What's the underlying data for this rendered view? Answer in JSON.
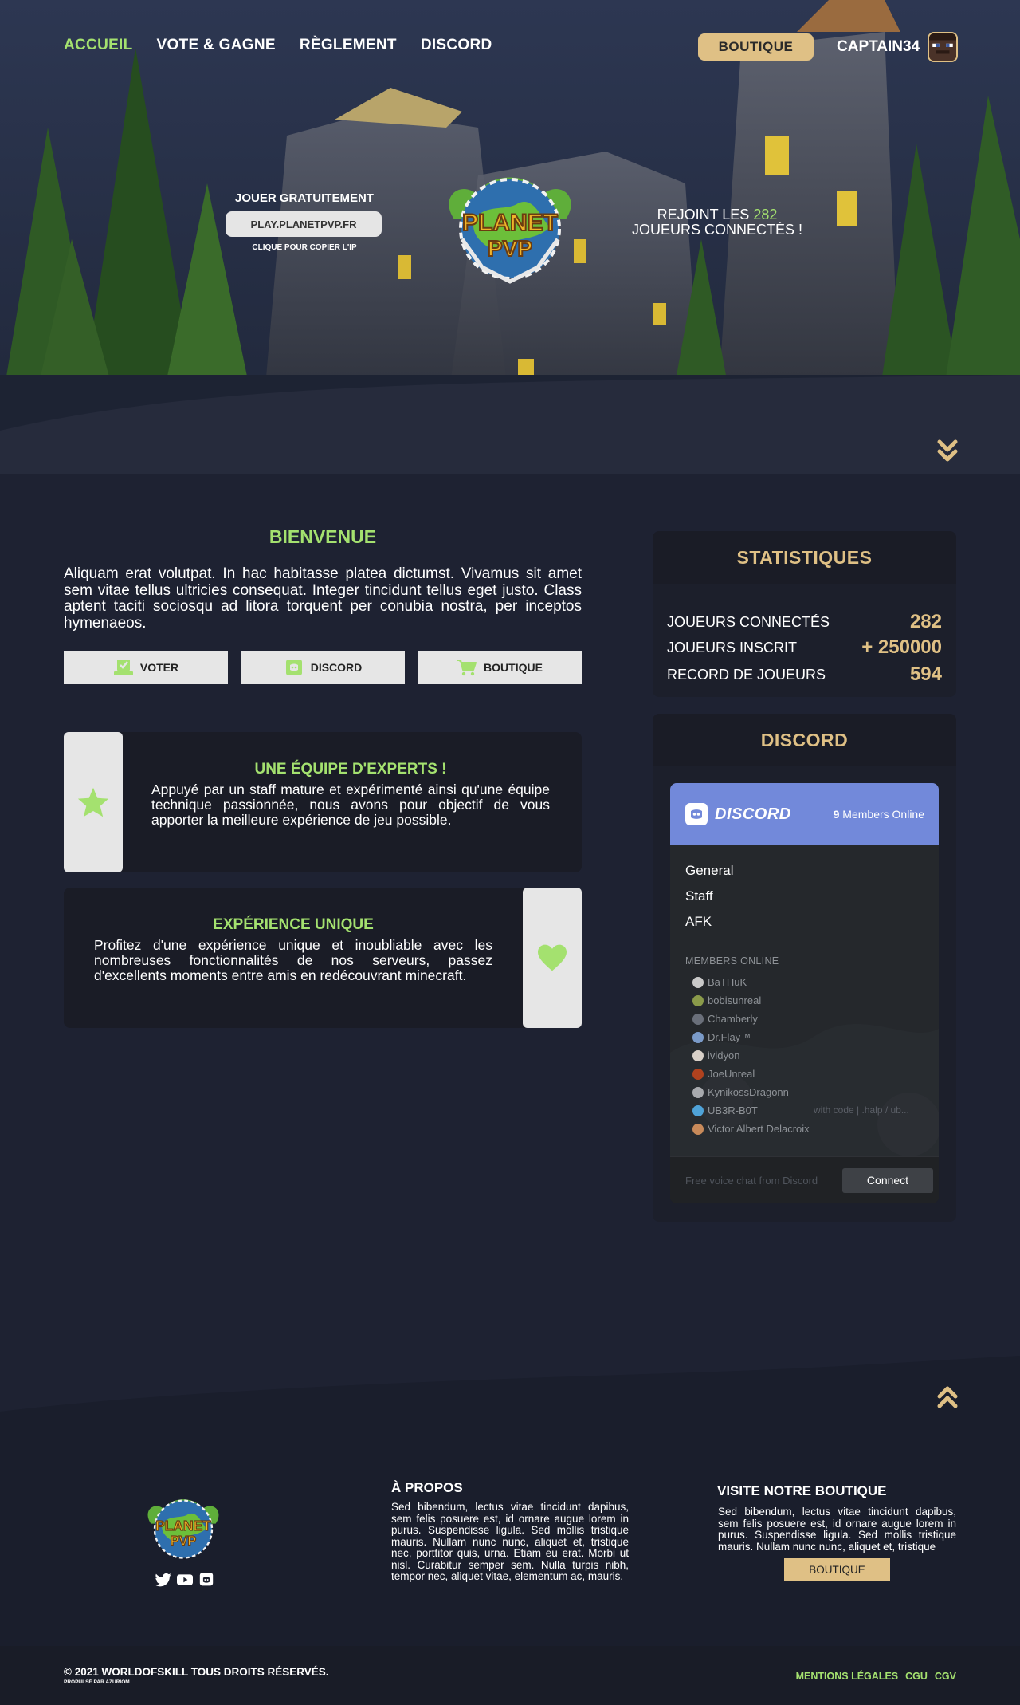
{
  "nav": {
    "items": [
      "ACCUEIL",
      "VOTE & GAGNE",
      "RÈGLEMENT",
      "DISCORD"
    ],
    "shop_label": "BOUTIQUE",
    "username": "CAPTAIN34"
  },
  "hero": {
    "play_title": "JOUER GRATUITEMENT",
    "server_ip": "PLAY.PLANETPVP.FR",
    "copy_hint": "CLIQUE POUR COPIER L'IP",
    "join_prefix": "REJOINT LES",
    "online_count": "282",
    "join_suffix": "JOUEURS CONNECTÉS !",
    "logo_text_1": "PLANET",
    "logo_text_2": "PVP"
  },
  "welcome": {
    "title": "BIENVENUE",
    "text": "Aliquam erat volutpat. In hac habitasse platea dictumst. Vivamus sit amet sem vitae tellus ultricies consequat. Integer tincidunt tellus eget justo. Class aptent taciti sociosqu ad litora torquent per conubia nostra, per inceptos hymenaeos.",
    "buttons": [
      {
        "label": "VOTER",
        "icon": "vote-icon"
      },
      {
        "label": "DISCORD",
        "icon": "discord-icon"
      },
      {
        "label": "BOUTIQUE",
        "icon": "cart-icon"
      }
    ]
  },
  "features": [
    {
      "title": "UNE ÉQUIPE D'EXPERTS !",
      "text": "Appuyé par un staff mature et expérimenté ainsi qu'une équipe technique passionnée, nous avons pour objectif de vous apporter la meilleure expérience de jeu possible.",
      "icon": "star-icon"
    },
    {
      "title": "EXPÉRIENCE UNIQUE",
      "text": "Profitez d'une expérience unique et inoubliable avec les nombreuses fonctionnalités de nos serveurs, passez d'excellents moments entre amis en redécouvrant minecraft.",
      "icon": "heart-icon"
    }
  ],
  "stats": {
    "title": "STATISTIQUES",
    "rows": [
      {
        "label": "JOUEURS CONNECTÉS",
        "value": "282"
      },
      {
        "label": "JOUEURS INSCRIT",
        "value": "+ 250000"
      },
      {
        "label": "RECORD DE JOUEURS",
        "value": "594"
      }
    ]
  },
  "discord": {
    "title": "DISCORD",
    "brand": "DISCORD",
    "members_count": "9",
    "members_online_label": "Members Online",
    "channels": [
      "General",
      "Staff",
      "AFK"
    ],
    "members_title": "MEMBERS ONLINE",
    "members": [
      "BaTHuK",
      "bobisunreal",
      "Chamberly",
      "Dr.Flay™",
      "ividyon",
      "JoeUnreal",
      "KynikossDragonn",
      "UB3R-B0T",
      "Victor Albert Delacroix"
    ],
    "member_game": "with code | .halp / ub...",
    "footer_text": "Free voice chat from Discord",
    "connect_label": "Connect"
  },
  "footer": {
    "about_title": "À PROPOS",
    "about_text": "Sed bibendum, lectus vitae tincidunt dapibus, sem felis posuere est, id ornare augue lorem in purus. Suspendisse ligula. Sed mollis tristique mauris. Nullam nunc nunc, aliquet et, tristique nec, porttitor quis, urna. Etiam eu erat. Morbi ut nisl. Curabitur semper sem. Nulla turpis nibh, tempor nec, aliquet vitae, elementum ac, mauris.",
    "shop_title": "VISITE NOTRE BOUTIQUE",
    "shop_text": "Sed bibendum, lectus vitae tincidunt dapibus, sem felis posuere est, id ornare augue lorem in purus. Suspendisse ligula. Sed mollis tristique mauris. Nullam nunc nunc, aliquet et, tristique",
    "shop_button": "BOUTIQUE",
    "copyright": "© 2021 WORLDOFSKILL TOUS DROITS RÉSERVÉS.",
    "powered": "PROPULSÉ PAR AZURIOM.",
    "legal_links": [
      "MENTIONS LÉGALES",
      "CGU",
      "CGV"
    ]
  },
  "colors": {
    "accent_green": "#a4e16f",
    "accent_gold": "#dfc085",
    "background": "#1e2232",
    "panel": "#1a1c26",
    "discord_blurple": "#7289da"
  }
}
